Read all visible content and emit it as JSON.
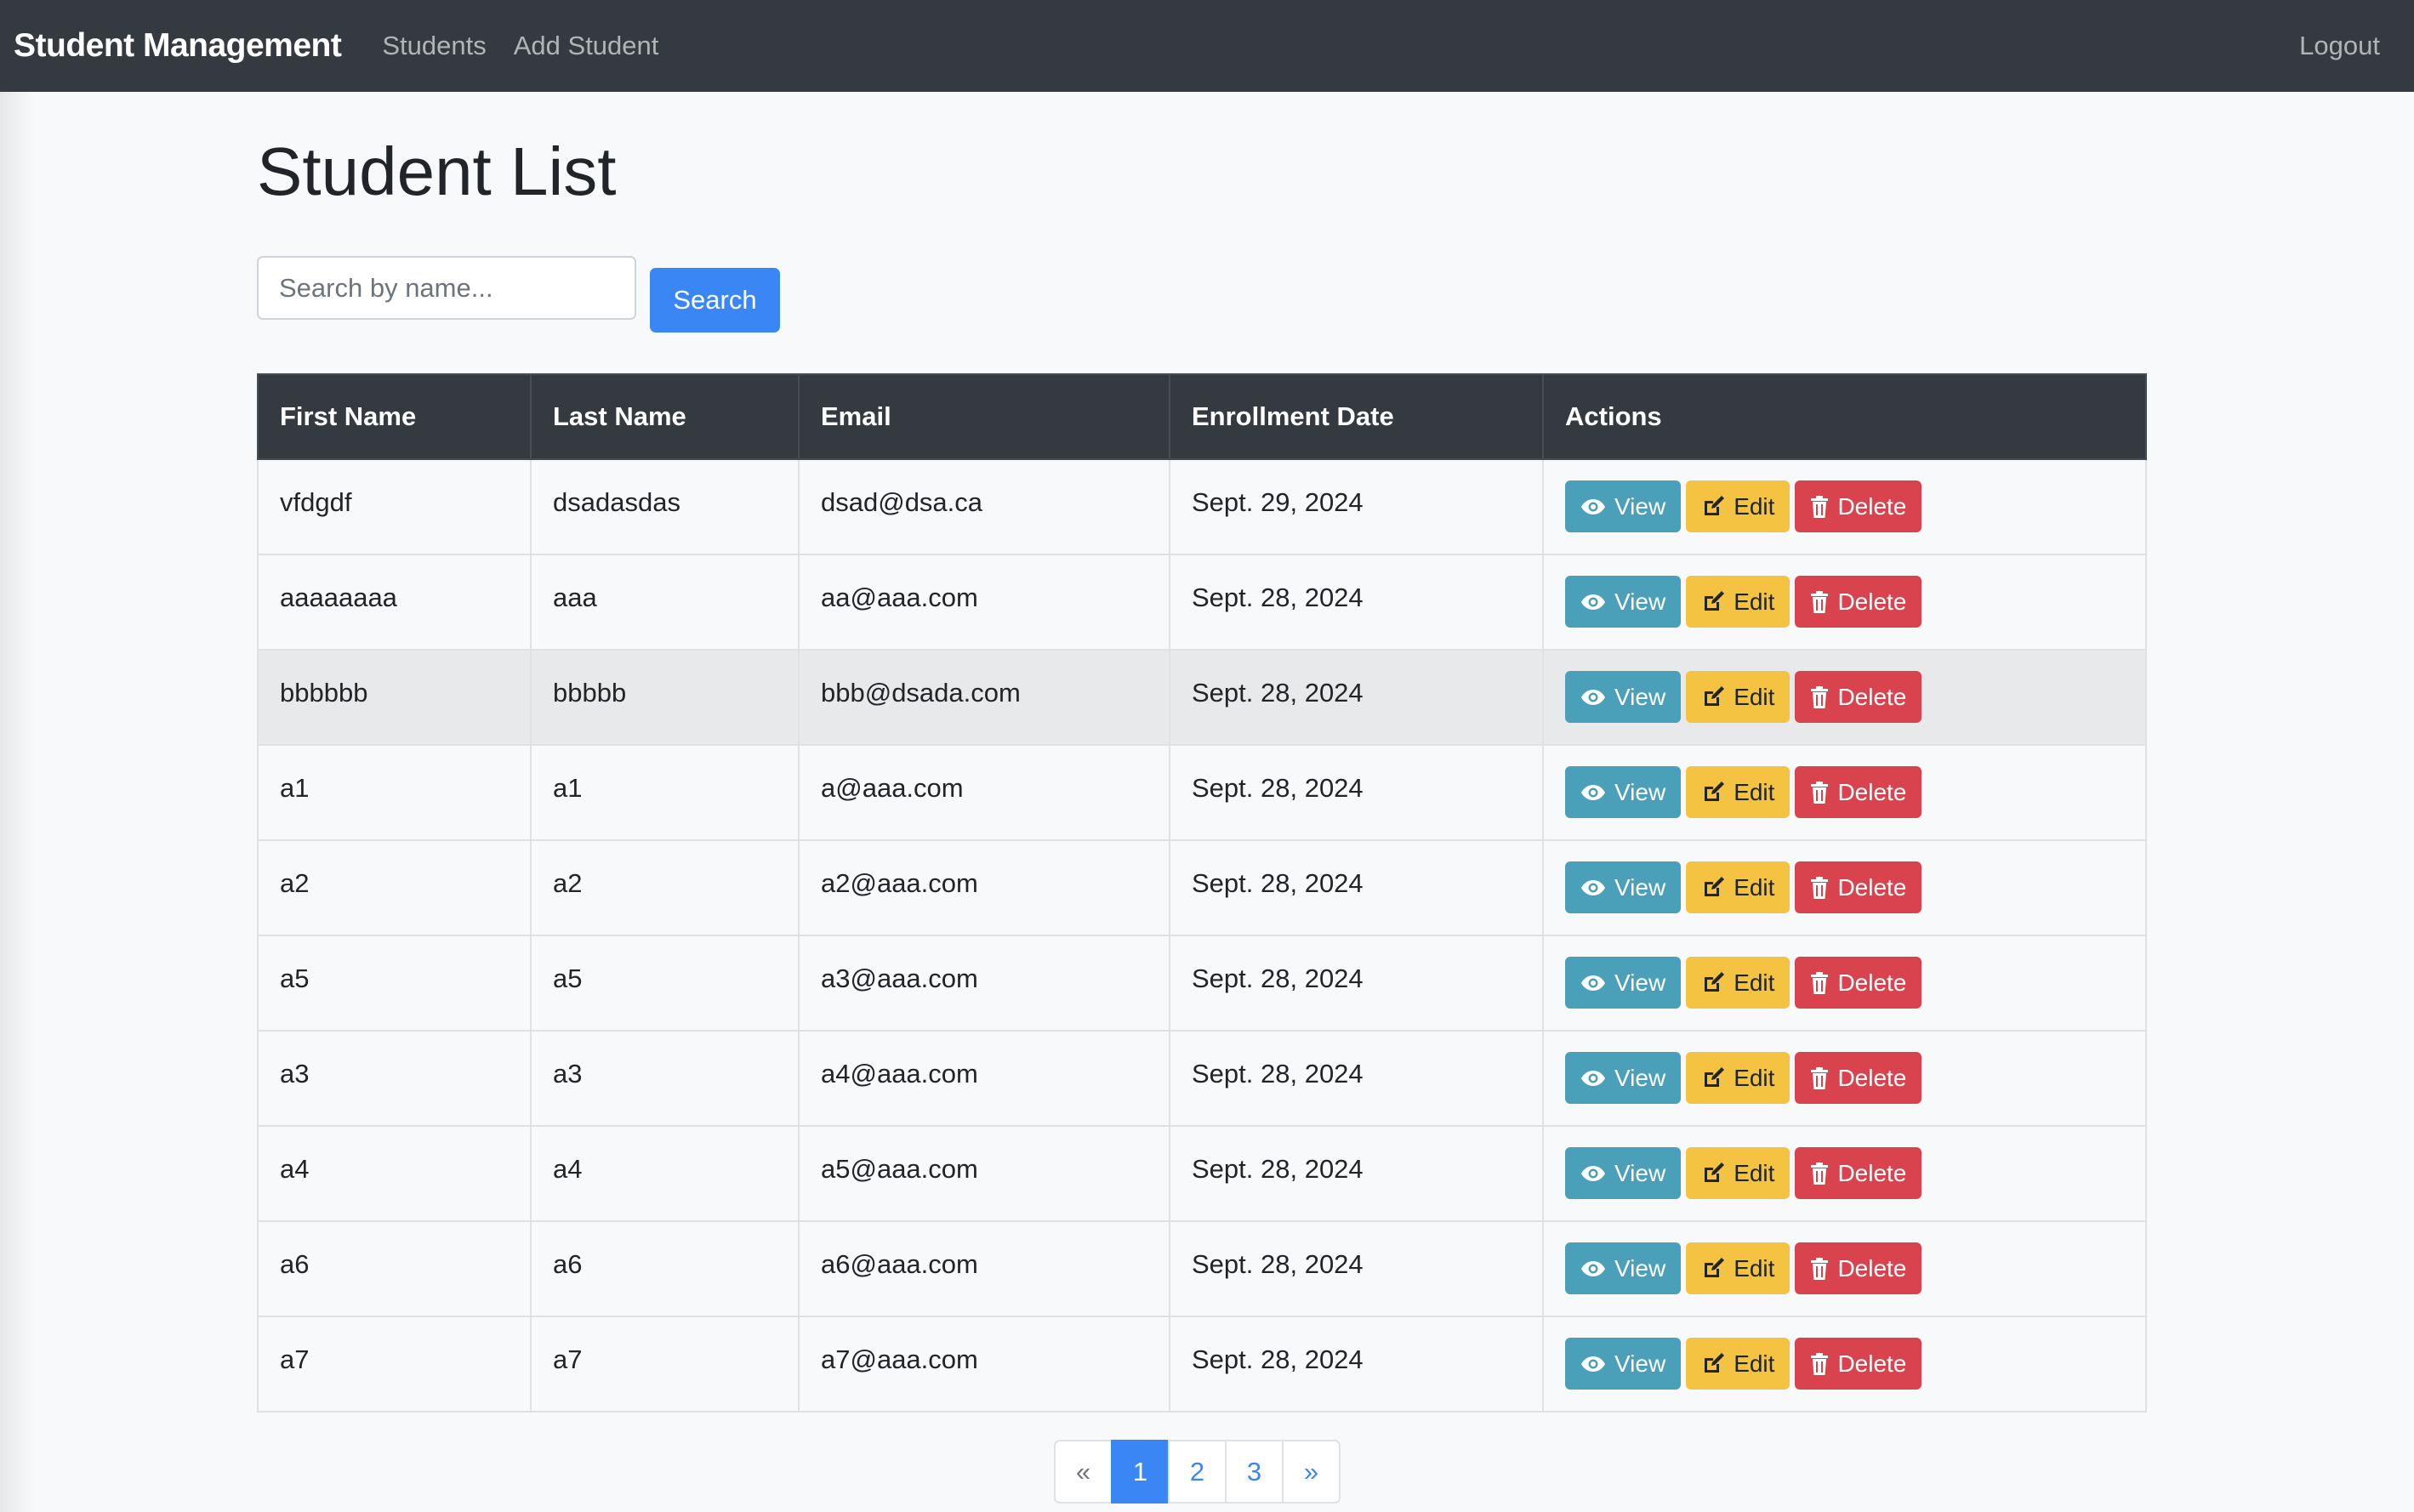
{
  "navbar": {
    "brand": "Student Management",
    "links": [
      "Students",
      "Add Student"
    ],
    "logout": "Logout"
  },
  "page": {
    "title": "Student List"
  },
  "search": {
    "placeholder": "Search by name...",
    "value": "",
    "button_label": "Search"
  },
  "table": {
    "headers": [
      "First Name",
      "Last Name",
      "Email",
      "Enrollment Date",
      "Actions"
    ],
    "action_labels": {
      "view": "View",
      "edit": "Edit",
      "delete": "Delete"
    },
    "rows": [
      {
        "first": "vfdgdf",
        "last": "dsadasdas",
        "email": "dsad@dsa.ca",
        "date": "Sept. 29, 2024"
      },
      {
        "first": "aaaaaaaa",
        "last": "aaa",
        "email": "aa@aaa.com",
        "date": "Sept. 28, 2024"
      },
      {
        "first": "bbbbbb",
        "last": "bbbbb",
        "email": "bbb@dsada.com",
        "date": "Sept. 28, 2024"
      },
      {
        "first": "a1",
        "last": "a1",
        "email": "a@aaa.com",
        "date": "Sept. 28, 2024"
      },
      {
        "first": "a2",
        "last": "a2",
        "email": "a2@aaa.com",
        "date": "Sept. 28, 2024"
      },
      {
        "first": "a5",
        "last": "a5",
        "email": "a3@aaa.com",
        "date": "Sept. 28, 2024"
      },
      {
        "first": "a3",
        "last": "a3",
        "email": "a4@aaa.com",
        "date": "Sept. 28, 2024"
      },
      {
        "first": "a4",
        "last": "a4",
        "email": "a5@aaa.com",
        "date": "Sept. 28, 2024"
      },
      {
        "first": "a6",
        "last": "a6",
        "email": "a6@aaa.com",
        "date": "Sept. 28, 2024"
      },
      {
        "first": "a7",
        "last": "a7",
        "email": "a7@aaa.com",
        "date": "Sept. 28, 2024"
      }
    ]
  },
  "pagination": {
    "prev": "«",
    "pages": [
      "1",
      "2",
      "3"
    ],
    "active_page": "1",
    "next": "»"
  },
  "colors": {
    "navbar_bg": "#343a40",
    "primary": "#3a86f5",
    "info": "#4aa0b8",
    "warning": "#f5c342",
    "danger": "#d9434e"
  },
  "icons": {
    "view": "eye-icon",
    "edit": "edit-icon",
    "delete": "trash-icon"
  }
}
